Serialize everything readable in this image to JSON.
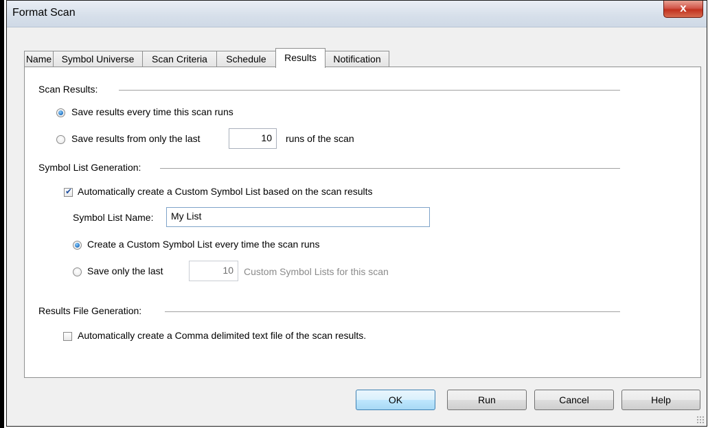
{
  "window": {
    "title": "Format Scan",
    "close_label": "x"
  },
  "tabs": [
    {
      "label": "Name"
    },
    {
      "label": "Symbol Universe"
    },
    {
      "label": "Scan Criteria"
    },
    {
      "label": "Schedule"
    },
    {
      "label": "Results",
      "active": true
    },
    {
      "label": "Notification"
    }
  ],
  "scan_results": {
    "heading": "Scan Results:",
    "option_every": "Save results every time this scan runs",
    "option_last_prefix": "Save results from only the last",
    "last_runs_value": "10",
    "option_last_suffix": "runs of the scan",
    "selected": "every"
  },
  "symbol_list": {
    "heading": "Symbol List Generation:",
    "auto_create_label": "Automatically create a Custom Symbol List based on the scan results",
    "auto_create_checked": true,
    "name_label": "Symbol List Name:",
    "name_value": "My List",
    "option_every": "Create a Custom Symbol List every time the scan runs",
    "option_last_prefix": "Save only the last",
    "last_lists_value": "10",
    "option_last_suffix": "Custom Symbol Lists for this scan",
    "selected": "every"
  },
  "results_file": {
    "heading": "Results File Generation:",
    "auto_create_label": "Automatically create a Comma delimited text file of the scan results.",
    "auto_create_checked": false
  },
  "buttons": {
    "ok": "OK",
    "run": "Run",
    "cancel": "Cancel",
    "help": "Help"
  }
}
